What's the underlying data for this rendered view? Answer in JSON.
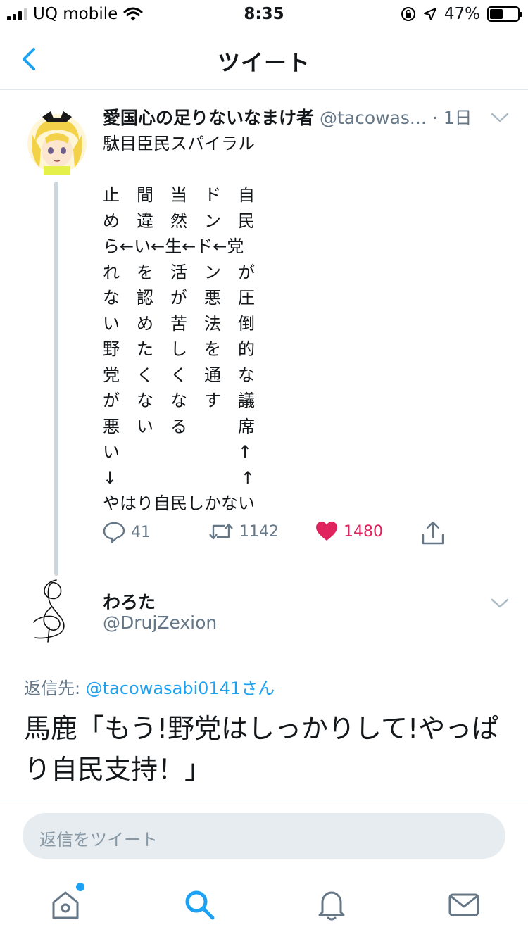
{
  "status_bar": {
    "carrier": "UQ mobile",
    "time": "8:35",
    "battery_percent": "47%",
    "battery_level": 0.47,
    "icons": [
      "signal-icon",
      "wifi-icon",
      "orientation-lock-icon",
      "location-icon",
      "battery-icon"
    ]
  },
  "nav": {
    "title": "ツイート",
    "back_icon": "chevron-left-icon"
  },
  "tweet": {
    "author_name": "愛国心の足りないなまけ者",
    "author_handle": "@tacowas...",
    "time": "· 1日",
    "text": "駄目臣民スパイラル\n\n止　間　当　ド　自\nめ　違　然　ン　民\nら←い←生←ド←党\nれ　を　活　ン　が\nな　認　が　悪　圧\nい　め　苦　法　倒\n野　た　し　を　的\n党　く　く　通　な\nが　な　な　す　議\n悪　い　る　　　席\nい　　　　　　　↑\n↓　　　　　　　 ↑\nやはり自民しかない",
    "replies": "41",
    "retweets": "1142",
    "likes": "1480",
    "accent_color": "#1da1f2",
    "like_color": "#e0245e"
  },
  "reply": {
    "author_name": "わろた",
    "author_handle": "@DrujZexion",
    "reply_to_prefix": "返信先: ",
    "reply_to_handle": "@tacowasabi0141さん",
    "text": "馬鹿「もう!野党はしっかりして!やっぱり自民支持！」"
  },
  "compose": {
    "placeholder": "返信をツイート"
  },
  "tabbar": {
    "items": [
      "home-icon",
      "search-icon",
      "notifications-icon",
      "messages-icon"
    ]
  }
}
